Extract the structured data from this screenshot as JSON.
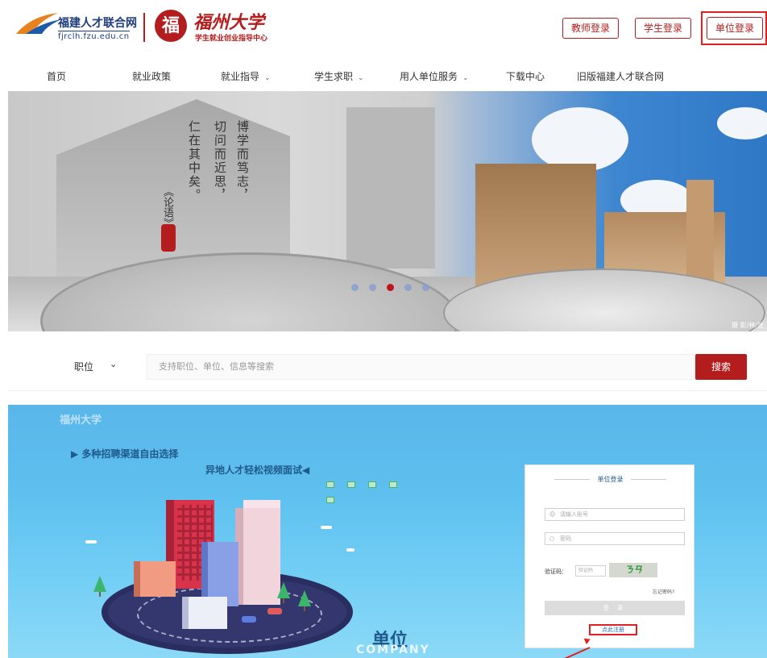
{
  "header": {
    "logo_title": "福建人才联合网",
    "logo_url": "fjrclh.fzu.edu.cn",
    "seal_char": "福",
    "university_name": "福州大学",
    "university_sub": "学生就业创业指导中心",
    "teacher_login": "教师登录",
    "student_login": "学生登录",
    "org_login": "单位登录"
  },
  "nav": {
    "items": [
      {
        "label": "首页",
        "has_dropdown": false
      },
      {
        "label": "就业政策",
        "has_dropdown": false
      },
      {
        "label": "就业指导",
        "has_dropdown": true
      },
      {
        "label": "学生求职",
        "has_dropdown": true
      },
      {
        "label": "用人单位服务",
        "has_dropdown": true
      },
      {
        "label": "下载中心",
        "has_dropdown": false
      },
      {
        "label": "旧版福建人才联合网",
        "has_dropdown": false
      }
    ],
    "chevron": "⌄"
  },
  "banner": {
    "poem_col1": "博学而笃志，",
    "poem_col2": "切问而近思，",
    "poem_col3": "仁在其中矣。",
    "book": "《论语》",
    "slide_count": 5,
    "active_slide": 3,
    "credit": "摄 影/林/张"
  },
  "search": {
    "select_label": "职位",
    "placeholder": "支持职位、单位、信息等搜索",
    "button_label": "搜索"
  },
  "login_page": {
    "brand": "福州大学",
    "slogan1": "▶ 多种招聘渠道自由选择",
    "slogan2": "异地人才轻松视频面试◀",
    "big_label": "单位",
    "big_label_en": "COMPANY",
    "card": {
      "title": "单位登录",
      "account_placeholder": "请输入账号",
      "password_placeholder": "密码",
      "captcha_label": "验证码：",
      "captcha_placeholder": "验证码",
      "captcha_text": "ㄋㄢ",
      "forgot": "忘记密码?",
      "submit": "登 录",
      "register": "点此注册"
    }
  },
  "colors": {
    "brand_red": "#b31d1d",
    "highlight_red": "#e02020",
    "login_bg": "#5ec0ef"
  }
}
